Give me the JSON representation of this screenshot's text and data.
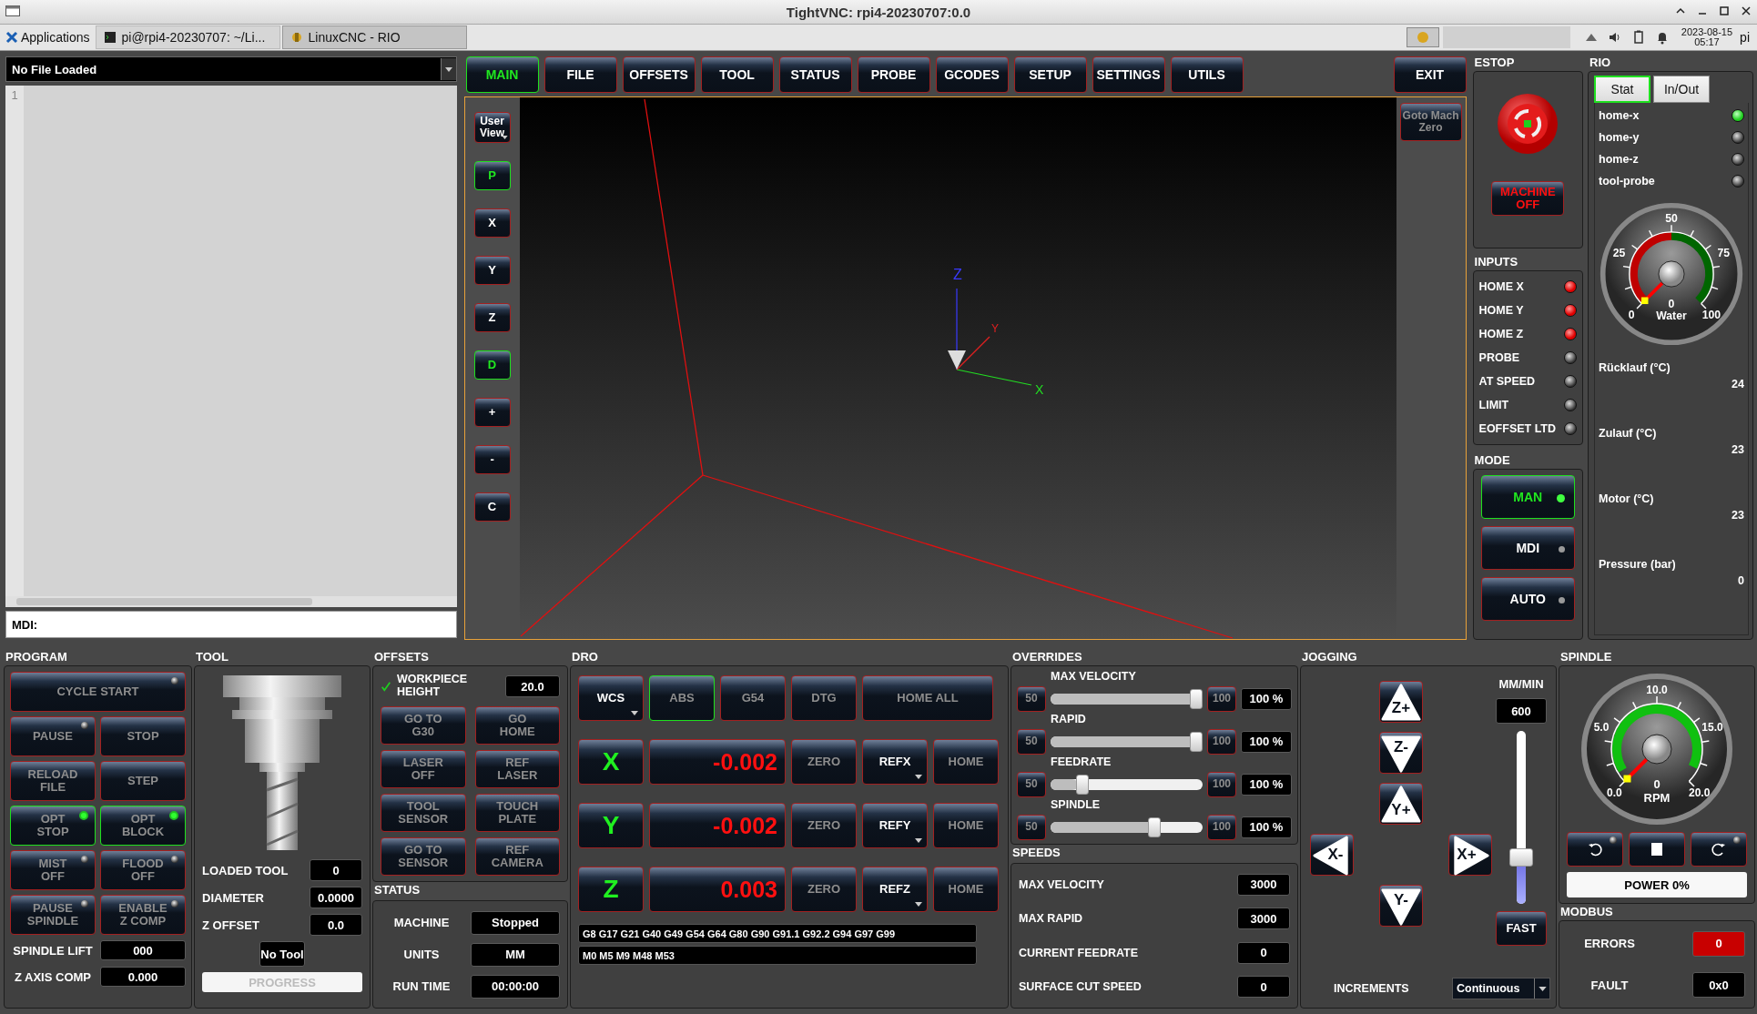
{
  "window": {
    "title": "TightVNC: rpi4-20230707:0.0"
  },
  "taskbar": {
    "menu": "Applications",
    "windows": [
      {
        "label": "pi@rpi4-20230707: ~/Li...",
        "kind": "terminal",
        "selected": false
      },
      {
        "label": "LinuxCNC - RIO",
        "kind": "app",
        "selected": true
      }
    ],
    "date": "2023-08-15",
    "time": "05:17",
    "user": "pi"
  },
  "editor": {
    "file": "No File Loaded",
    "line_numbers": [
      "1"
    ],
    "mdi_label": "MDI:"
  },
  "tabs": [
    {
      "label": "MAIN",
      "selected": true
    },
    {
      "label": "FILE",
      "selected": false
    },
    {
      "label": "OFFSETS",
      "selected": false
    },
    {
      "label": "TOOL",
      "selected": false
    },
    {
      "label": "STATUS",
      "selected": false
    },
    {
      "label": "PROBE",
      "selected": false
    },
    {
      "label": "GCODES",
      "selected": false
    },
    {
      "label": "SETUP",
      "selected": false
    },
    {
      "label": "SETTINGS",
      "selected": false
    },
    {
      "label": "UTILS",
      "selected": false
    }
  ],
  "exit_button": "EXIT",
  "view_buttons": [
    {
      "label": "User View",
      "kind": "menu",
      "selected": false
    },
    {
      "label": "P",
      "kind": "plain",
      "selected": true
    },
    {
      "label": "X",
      "kind": "plain",
      "selected": false
    },
    {
      "label": "Y",
      "kind": "plain",
      "selected": false
    },
    {
      "label": "Z",
      "kind": "plain",
      "selected": false
    },
    {
      "label": "D",
      "kind": "plain",
      "selected": true
    },
    {
      "label": "+",
      "kind": "plain",
      "selected": false
    },
    {
      "label": "-",
      "kind": "plain",
      "selected": false
    },
    {
      "label": "C",
      "kind": "plain",
      "selected": false
    }
  ],
  "view": {
    "axis_labels": [
      "Z",
      "Y",
      "X"
    ],
    "goto_button": "Goto Mach Zero"
  },
  "estop": {
    "title": "ESTOP",
    "machine_button": "MACHINE OFF"
  },
  "inputs": {
    "title": "INPUTS",
    "items": [
      {
        "label": "HOME X",
        "on": true
      },
      {
        "label": "HOME Y",
        "on": true
      },
      {
        "label": "HOME Z",
        "on": true
      },
      {
        "label": "PROBE",
        "on": false
      },
      {
        "label": "AT SPEED",
        "on": false
      },
      {
        "label": "LIMIT",
        "on": false
      },
      {
        "label": "EOFFSET LTD",
        "on": false
      }
    ]
  },
  "mode": {
    "title": "MODE",
    "items": [
      {
        "label": "MAN",
        "selected": true
      },
      {
        "label": "MDI",
        "selected": false
      },
      {
        "label": "AUTO",
        "selected": false
      }
    ]
  },
  "rio": {
    "title": "RIO",
    "tabs": [
      {
        "label": "Stat",
        "selected": true
      },
      {
        "label": "In/Out",
        "selected": false
      }
    ],
    "pins": [
      {
        "label": "home-x",
        "on": true
      },
      {
        "label": "home-y",
        "on": false
      },
      {
        "label": "home-z",
        "on": false
      },
      {
        "label": "tool-probe",
        "on": false
      }
    ],
    "gauge": {
      "ticks": [
        "0",
        "25",
        "50",
        "75",
        "100"
      ],
      "reading": "0",
      "label": "Water",
      "level": 0
    },
    "values": [
      {
        "label": "Rücklauf (°C)",
        "value": "24"
      },
      {
        "label": "Zulauf (°C)",
        "value": "23"
      },
      {
        "label": "Motor (°C)",
        "value": "23"
      },
      {
        "label": "Pressure (bar)",
        "value": "0"
      }
    ]
  },
  "program": {
    "title": "PROGRAM",
    "cycle_start": {
      "label": "CYCLE START",
      "on": false
    },
    "buttons": [
      {
        "label": "PAUSE",
        "kind": "toggle",
        "on": false
      },
      {
        "label": "STOP",
        "kind": "plain"
      },
      {
        "label": "RELOAD\nFILE",
        "kind": "plain"
      },
      {
        "label": "STEP",
        "kind": "plain"
      },
      {
        "label": "OPT\nSTOP",
        "kind": "toggle",
        "on": true
      },
      {
        "label": "OPT\nBLOCK",
        "kind": "toggle",
        "on": true
      },
      {
        "label": "MIST\nOFF",
        "kind": "toggle",
        "on": false
      },
      {
        "label": "FLOOD\nOFF",
        "kind": "toggle",
        "on": false
      },
      {
        "label": "PAUSE\nSPINDLE",
        "kind": "toggle",
        "on": false
      },
      {
        "label": "ENABLE\nZ COMP",
        "kind": "toggle",
        "on": false
      }
    ],
    "fields": [
      {
        "label": "SPINDLE LIFT",
        "value": "000"
      },
      {
        "label": "Z AXIS COMP",
        "value": "0.000"
      }
    ]
  },
  "tool": {
    "title": "TOOL",
    "fields": [
      {
        "label": "LOADED TOOL",
        "value": "0"
      },
      {
        "label": "DIAMETER",
        "value": "0.0000"
      },
      {
        "label": "Z OFFSET",
        "value": "0.0"
      }
    ],
    "name": "No Tool",
    "progress": {
      "label": "PROGRESS",
      "level": 0
    }
  },
  "offsets": {
    "title": "OFFSETS",
    "workpiece": {
      "label": "WORKPIECE\nHEIGHT",
      "checked": true,
      "value": "20.0"
    },
    "buttons": [
      "GO TO\nG30",
      "GO\nHOME",
      "LASER\nOFF",
      "REF\nLASER",
      "TOOL\nSENSOR",
      "TOUCH\nPLATE",
      "GO TO\nSENSOR",
      "REF\nCAMERA"
    ]
  },
  "status": {
    "title": "STATUS",
    "rows": [
      {
        "label": "MACHINE",
        "value": "Stopped"
      },
      {
        "label": "UNITS",
        "value": "MM"
      },
      {
        "label": "RUN TIME",
        "value": "00:00:00"
      }
    ]
  },
  "dro": {
    "title": "DRO",
    "buttons": [
      {
        "label": "WCS",
        "kind": "menu",
        "selected": false,
        "disabled": false
      },
      {
        "label": "ABS",
        "kind": "plain",
        "selected": true,
        "disabled": true
      },
      {
        "label": "G54",
        "kind": "plain",
        "selected": false,
        "disabled": true
      },
      {
        "label": "DTG",
        "kind": "plain",
        "selected": false,
        "disabled": true
      },
      {
        "label": "HOME ALL",
        "kind": "wide",
        "selected": false,
        "disabled": true
      }
    ],
    "axes": [
      {
        "axis": "X",
        "value": "-0.002",
        "zero": "ZERO",
        "ref": "REFX",
        "home": "HOME"
      },
      {
        "axis": "Y",
        "value": "-0.002",
        "zero": "ZERO",
        "ref": "REFY",
        "home": "HOME"
      },
      {
        "axis": "Z",
        "value": "0.003",
        "zero": "ZERO",
        "ref": "REFZ",
        "home": "HOME"
      }
    ],
    "gcodes": "G8 G17 G21 G40 G49 G54 G64 G80 G90 G91.1 G92.2 G94 G97 G99",
    "mcodes": "M0 M5 M9 M48 M53"
  },
  "overrides": {
    "title": "OVERRIDES",
    "items": [
      {
        "label": "MAX VELOCITY",
        "min": "50",
        "max": "100",
        "level": 1,
        "reading": "100 %"
      },
      {
        "label": "RAPID",
        "min": "50",
        "max": "100",
        "level": 1,
        "reading": "100 %"
      },
      {
        "label": "FEEDRATE",
        "min": "50",
        "max": "100",
        "level": 0.18,
        "reading": "100 %"
      },
      {
        "label": "SPINDLE",
        "min": "50",
        "max": "100",
        "level": 0.7,
        "reading": "100 %"
      }
    ]
  },
  "speeds": {
    "title": "SPEEDS",
    "rows": [
      {
        "label": "MAX VELOCITY",
        "value": "3000"
      },
      {
        "label": "MAX RAPID",
        "value": "3000"
      },
      {
        "label": "CURRENT FEEDRATE",
        "value": "0"
      },
      {
        "label": "SURFACE CUT SPEED",
        "value": "0"
      }
    ]
  },
  "jogging": {
    "title": "JOGGING",
    "buttons": [
      {
        "label": "Z+",
        "kind": "up"
      },
      {
        "label": "Z-",
        "kind": "down"
      },
      {
        "label": "Y+",
        "kind": "up"
      },
      {
        "label": "X-",
        "kind": "left"
      },
      {
        "label": "X+",
        "kind": "right"
      },
      {
        "label": "Y-",
        "kind": "down"
      }
    ],
    "unit": "MM/MIN",
    "rate": "600",
    "level": 0.27,
    "fast": "FAST",
    "increments_label": "INCREMENTS",
    "increments": "Continuous"
  },
  "spindle": {
    "title": "SPINDLE",
    "gauge": {
      "ticks": [
        "0.0",
        "5.0",
        "10.0",
        "15.0",
        "20.0"
      ],
      "reading": "0",
      "label": "RPM",
      "level": 0
    },
    "buttons": [
      {
        "kind": "ccw",
        "on": false
      },
      {
        "kind": "stop"
      },
      {
        "kind": "cw",
        "on": false
      }
    ],
    "power": "POWER 0%"
  },
  "modbus": {
    "title": "MODBUS",
    "rows": [
      {
        "label": "ERRORS",
        "value": "0",
        "alert": true
      },
      {
        "label": "FAULT",
        "value": "0x0",
        "alert": false
      }
    ]
  }
}
